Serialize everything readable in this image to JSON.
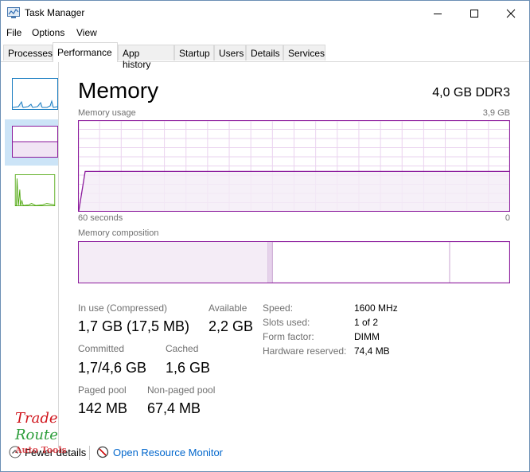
{
  "window": {
    "title": "Task Manager"
  },
  "menu": [
    "File",
    "Options",
    "View"
  ],
  "tabs": [
    "Processes",
    "Performance",
    "App history",
    "Startup",
    "Users",
    "Details",
    "Services"
  ],
  "memory": {
    "heading": "Memory",
    "spec": "4,0 GB DDR3",
    "usage_label": "Memory usage",
    "usage_max": "3,9 GB",
    "time_left": "60 seconds",
    "time_right": "0",
    "composition_label": "Memory composition",
    "usage_fraction": 0.44,
    "composition": {
      "in_use_fraction": 0.44,
      "modified_fraction": 0.01,
      "standby_fraction": 0.41
    }
  },
  "stats": {
    "in_use_label": "In use (Compressed)",
    "in_use_value": "1,7 GB (17,5 MB)",
    "available_label": "Available",
    "available_value": "2,2 GB",
    "committed_label": "Committed",
    "committed_value": "1,7/4,6 GB",
    "cached_label": "Cached",
    "cached_value": "1,6 GB",
    "paged_label": "Paged pool",
    "paged_value": "142 MB",
    "nonpaged_label": "Non-paged pool",
    "nonpaged_value": "67,4 MB"
  },
  "specs": {
    "speed_label": "Speed:",
    "speed_value": "1600 MHz",
    "slots_label": "Slots used:",
    "slots_value": "1 of 2",
    "form_label": "Form factor:",
    "form_value": "DIMM",
    "hwres_label": "Hardware reserved:",
    "hwres_value": "74,4 MB"
  },
  "footer": {
    "details_label": "Fewer details",
    "resource_monitor": "Open Resource Monitor"
  },
  "watermark": {
    "line1": "Trade",
    "line2": "Route",
    "line3": "Auto Tools"
  },
  "colors": {
    "accent": "#8b1a9c",
    "grid": "#ead3ef",
    "fill": "#f4ecf6",
    "link": "#0066cc"
  }
}
